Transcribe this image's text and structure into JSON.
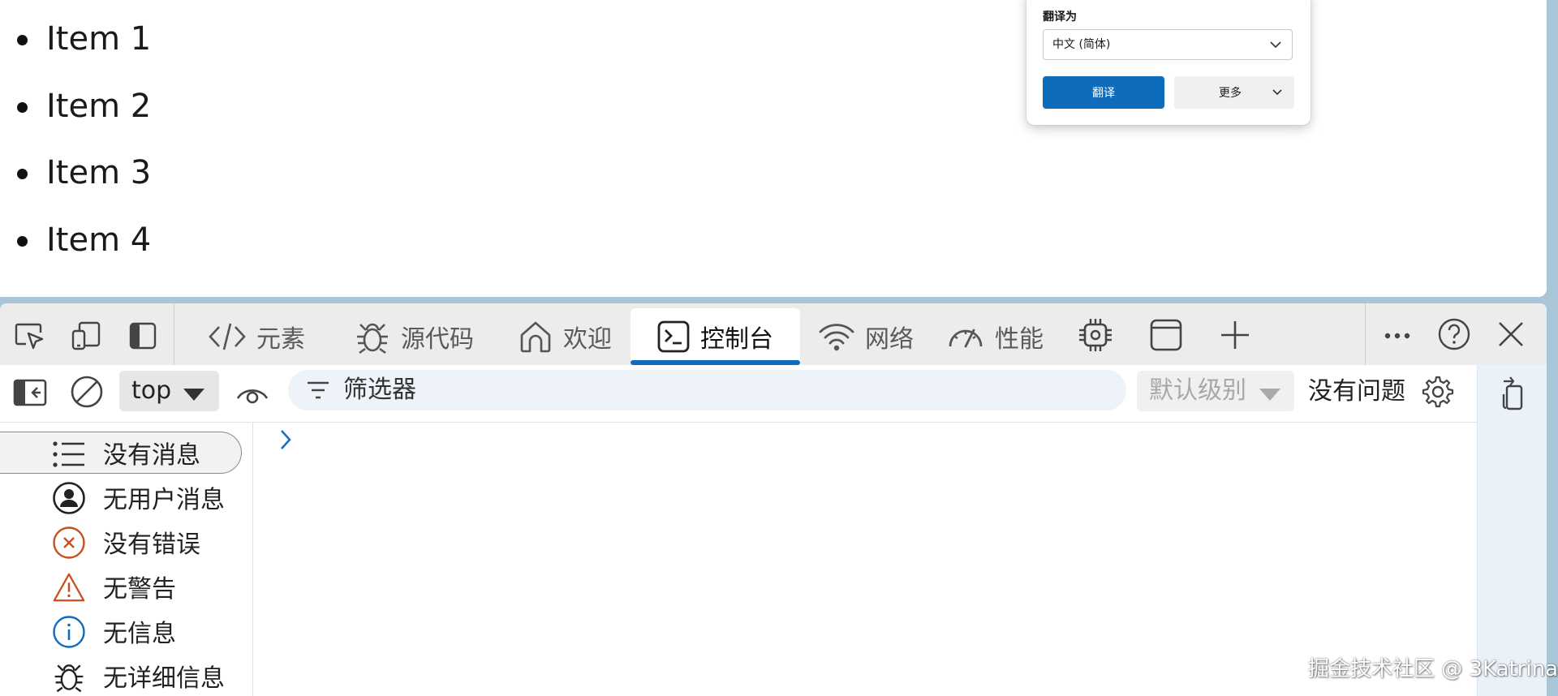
{
  "page": {
    "list_items": [
      "Item 1",
      "Item 2",
      "Item 3",
      "Item 4"
    ]
  },
  "translate_popup": {
    "label": "翻译为",
    "language_selected": "中文 (简体)",
    "translate_button": "翻译",
    "more_button": "更多"
  },
  "devtools": {
    "tabs": [
      {
        "label": "元素",
        "icon": "code-icon",
        "active": false
      },
      {
        "label": "源代码",
        "icon": "bug-icon",
        "active": false
      },
      {
        "label": "欢迎",
        "icon": "home-icon",
        "active": false
      },
      {
        "label": "控制台",
        "icon": "terminal-icon",
        "active": true
      },
      {
        "label": "网络",
        "icon": "wifi-icon",
        "active": false
      },
      {
        "label": "性能",
        "icon": "gauge-icon",
        "active": false
      }
    ],
    "toolbar": {
      "context": "top",
      "filter_placeholder": "筛选器",
      "level": "默认级别",
      "issues": "没有问题"
    },
    "sidebar": [
      {
        "label": "没有消息",
        "icon": "list-icon",
        "selected": true
      },
      {
        "label": "无用户消息",
        "icon": "user-circle-icon",
        "selected": false
      },
      {
        "label": "没有错误",
        "icon": "error-icon",
        "selected": false
      },
      {
        "label": "无警告",
        "icon": "warning-icon",
        "selected": false
      },
      {
        "label": "无信息",
        "icon": "info-icon",
        "selected": false
      },
      {
        "label": "无详细信息",
        "icon": "bug-icon",
        "selected": false
      }
    ],
    "colors": {
      "accent": "#0f6cbd",
      "error": "#c8501e",
      "warning": "#c8501e",
      "info": "#0f6cbd"
    }
  },
  "watermark": "掘金技术社区 @ 3Katrina"
}
